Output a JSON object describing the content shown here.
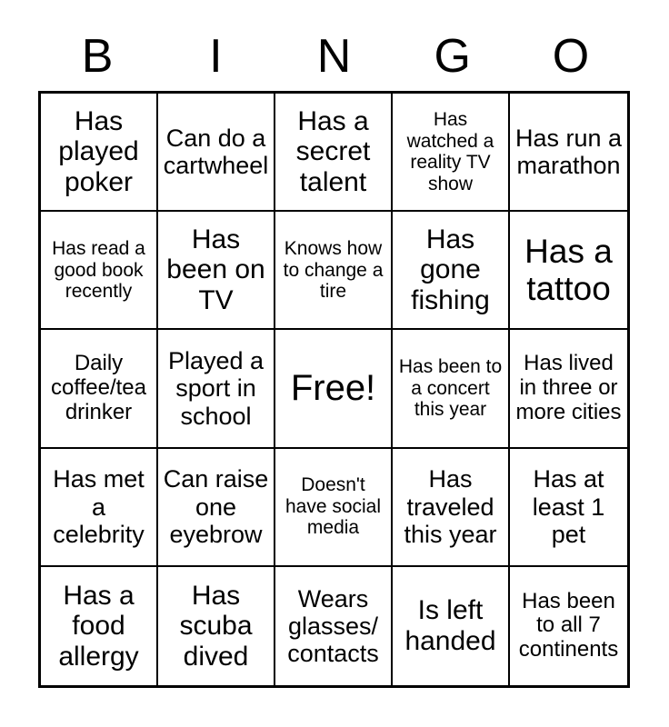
{
  "header": {
    "letters": [
      "B",
      "I",
      "N",
      "G",
      "O"
    ]
  },
  "grid": {
    "rows": 5,
    "columns": 5,
    "border_color": "#000000",
    "cell_background": "#ffffff",
    "text_color": "#000000",
    "cells": [
      {
        "text": "Has played poker",
        "size": "lg"
      },
      {
        "text": "Can do a cartwheel",
        "size": "md"
      },
      {
        "text": "Has a secret talent",
        "size": "lg"
      },
      {
        "text": "Has watched a reality TV show",
        "size": "xs"
      },
      {
        "text": "Has run a marathon",
        "size": "md"
      },
      {
        "text": "Has read a good book recently",
        "size": "xs"
      },
      {
        "text": "Has been on TV",
        "size": "lg"
      },
      {
        "text": "Knows how to change a tire",
        "size": "xs"
      },
      {
        "text": "Has gone fishing",
        "size": "lg"
      },
      {
        "text": "Has a tattoo",
        "size": "xl"
      },
      {
        "text": "Daily coffee/tea drinker",
        "size": "sm"
      },
      {
        "text": "Played a sport in school",
        "size": "md"
      },
      {
        "text": "Free!",
        "size": "xxl"
      },
      {
        "text": "Has been to a concert this year",
        "size": "xs"
      },
      {
        "text": "Has lived in three or more cities",
        "size": "sm"
      },
      {
        "text": "Has met a celebrity",
        "size": "md"
      },
      {
        "text": "Can raise one eyebrow",
        "size": "md"
      },
      {
        "text": "Doesn't have social media",
        "size": "xs"
      },
      {
        "text": "Has traveled this year",
        "size": "md"
      },
      {
        "text": "Has at least 1 pet",
        "size": "md"
      },
      {
        "text": "Has a food allergy",
        "size": "lg"
      },
      {
        "text": "Has scuba dived",
        "size": "lg"
      },
      {
        "text": "Wears glasses/ contacts",
        "size": "md"
      },
      {
        "text": "Is left handed",
        "size": "lg"
      },
      {
        "text": "Has been to all 7 continents",
        "size": "sm"
      }
    ]
  }
}
